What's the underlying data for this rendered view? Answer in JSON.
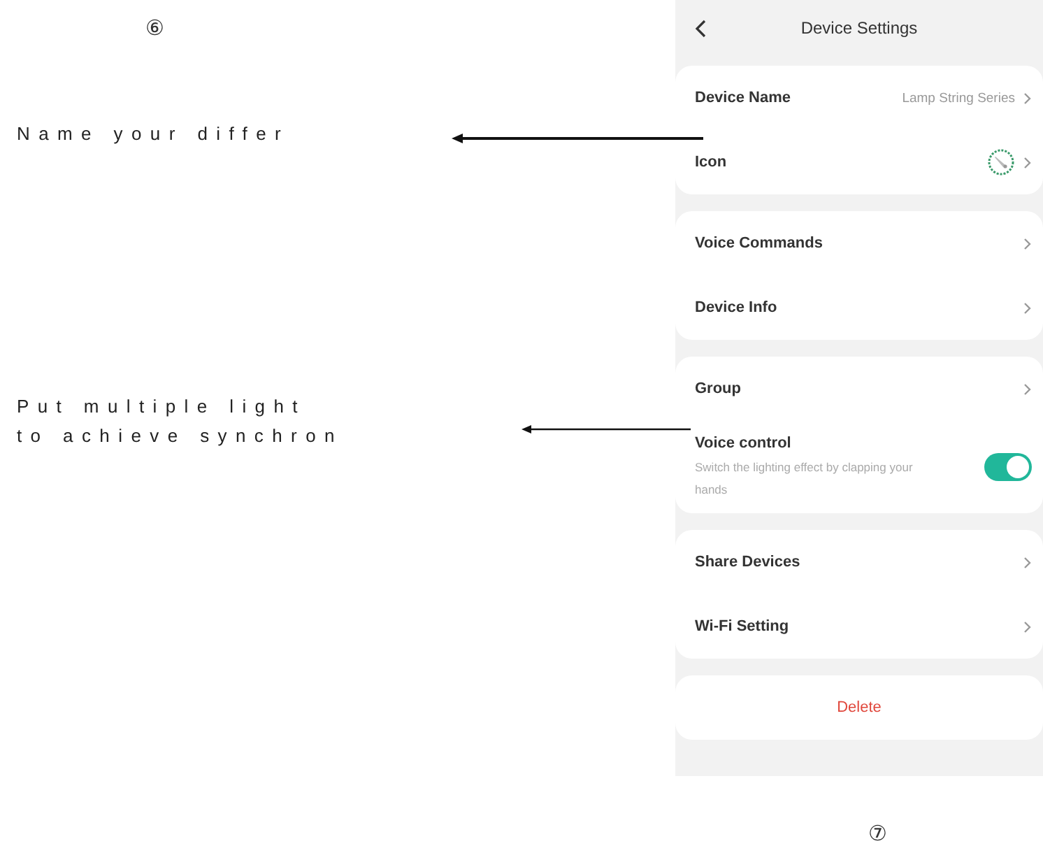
{
  "annotations": {
    "step_top": "⑥",
    "step_bottom": "⑦",
    "callouts": [
      {
        "lines": [
          "Name your differ"
        ]
      },
      {
        "lines": [
          "Put multiple light",
          "to achieve synchron"
        ]
      }
    ]
  },
  "phone": {
    "title": "Device Settings",
    "groups": [
      {
        "rows": [
          {
            "kind": "link",
            "label": "Device Name",
            "value": "Lamp String Series"
          },
          {
            "kind": "icon",
            "label": "Icon"
          }
        ]
      },
      {
        "rows": [
          {
            "kind": "link",
            "label": "Voice Commands"
          },
          {
            "kind": "link",
            "label": "Device Info"
          }
        ]
      },
      {
        "rows": [
          {
            "kind": "link",
            "label": "Group"
          },
          {
            "kind": "toggle",
            "label": "Voice control",
            "subtitle": "Switch the lighting effect by clapping your hands",
            "on": true
          }
        ]
      },
      {
        "rows": [
          {
            "kind": "link",
            "label": "Share Devices"
          },
          {
            "kind": "link",
            "label": "Wi-Fi Setting"
          }
        ]
      },
      {
        "rows": [
          {
            "kind": "danger",
            "label": "Delete"
          }
        ]
      }
    ]
  }
}
